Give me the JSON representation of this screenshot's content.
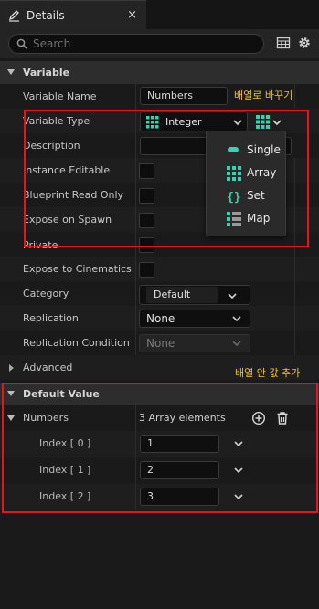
{
  "tab": {
    "title": "Details",
    "close_glyph": "×"
  },
  "search": {
    "placeholder": "Search"
  },
  "sections": {
    "variable": "Variable",
    "advanced": "Advanced",
    "default_value": "Default Value"
  },
  "variable": {
    "name_label": "Variable Name",
    "name_value": "Numbers",
    "type_label": "Variable Type",
    "type_value": "Integer",
    "description_label": "Description",
    "instance_editable_label": "Instance Editable",
    "blueprint_read_only_label": "Blueprint Read Only",
    "expose_on_spawn_label": "Expose on Spawn",
    "private_label": "Private",
    "expose_cinematics_label": "Expose to Cinematics",
    "category_label": "Category",
    "category_value": "Default",
    "replication_label": "Replication",
    "replication_value": "None",
    "replication_condition_label": "Replication Condition",
    "replication_condition_value": "None"
  },
  "container_menu": {
    "items": [
      {
        "label": "Single",
        "icon": "single-pill-icon"
      },
      {
        "label": "Array",
        "icon": "array-grid-icon"
      },
      {
        "label": "Set",
        "icon": "set-braces-icon"
      },
      {
        "label": "Map",
        "icon": "map-icon"
      }
    ]
  },
  "annotations": {
    "array_note": "배열로 바꾸기",
    "value_note": "배열 안 값 추가"
  },
  "default_value": {
    "numbers_label": "Numbers",
    "count_text": "3 Array elements",
    "elements": [
      {
        "label": "Index [ 0 ]",
        "value": "1"
      },
      {
        "label": "Index [ 1 ]",
        "value": "2"
      },
      {
        "label": "Index [ 2 ]",
        "value": "3"
      }
    ]
  },
  "colors": {
    "accent_teal": "#35d3b1",
    "annotation_yellow": "#f1c232",
    "highlight_red": "#e3161b",
    "panel_bg": "#1a1a1a"
  }
}
